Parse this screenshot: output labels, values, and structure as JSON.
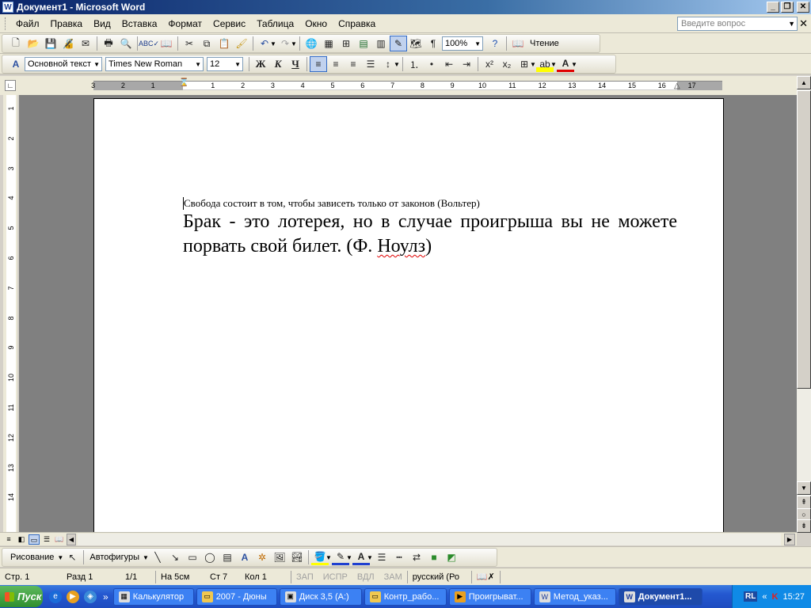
{
  "window": {
    "title": "Документ1 - Microsoft Word",
    "app_icon": "word-doc-icon"
  },
  "menu": {
    "items": [
      "Файл",
      "Правка",
      "Вид",
      "Вставка",
      "Формат",
      "Сервис",
      "Таблица",
      "Окно",
      "Справка"
    ],
    "ask_placeholder": "Введите вопрос"
  },
  "standard_toolbar": {
    "zoom": "100%",
    "reading_label": "Чтение"
  },
  "format_toolbar": {
    "style": "Основной текст",
    "font": "Times New Roman",
    "size": "12",
    "bold": "Ж",
    "italic": "К",
    "underline": "Ч"
  },
  "ruler": {
    "labels": [
      "3",
      "2",
      "1",
      "1",
      "2",
      "3",
      "4",
      "5",
      "6",
      "7",
      "8",
      "9",
      "10",
      "11",
      "12",
      "13",
      "14",
      "15",
      "16",
      "17"
    ]
  },
  "vertical_ruler": {
    "labels": [
      "1",
      "2",
      "3",
      "4",
      "5",
      "6",
      "7",
      "8",
      "9",
      "10",
      "11",
      "12",
      "13",
      "14"
    ]
  },
  "document": {
    "line1": "Свобода состоит в том, чтобы зависеть только от  законов (Вольтер)",
    "para_main": "Брак - это лотерея, но в случае проигрыша вы не можете порвать свой билет. (Ф.",
    "para_name": "Ноулз",
    "para_end": ")"
  },
  "drawing_toolbar": {
    "drawing_label": "Рисование",
    "autoshapes_label": "Автофигуры"
  },
  "status": {
    "page": "Стр.  1",
    "section": "Разд  1",
    "pages": "1/1",
    "at": "На  5см",
    "line": "Ст  7",
    "col": "Кол  1",
    "rec": "ЗАП",
    "trk": "ИСПР",
    "ext": "ВДЛ",
    "ovr": "ЗАМ",
    "lang": "русский (Ро"
  },
  "taskbar": {
    "start": "Пуск",
    "tasks": [
      "Калькулятор",
      "2007 - Дюны",
      "Диск 3,5 (A:)",
      "Контр_рабо...",
      "Проигрыват...",
      "Метод_указ...",
      "Документ1..."
    ],
    "lang": "RL",
    "clock": "15:27"
  }
}
